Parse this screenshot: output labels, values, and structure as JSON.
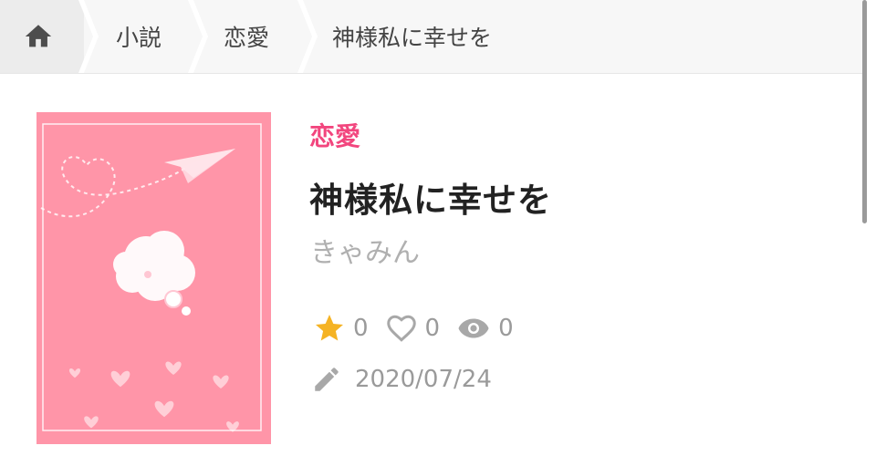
{
  "breadcrumb": {
    "home_icon": "home-icon",
    "items": [
      "小説",
      "恋愛",
      "神様私に幸せを"
    ]
  },
  "book": {
    "genre": "恋愛",
    "title": "神様私に幸せを",
    "author": "きゃみん",
    "stats": {
      "stars": "0",
      "likes": "0",
      "views": "0"
    },
    "updated": "2020/07/24"
  },
  "colors": {
    "genre": "#f2467e",
    "cover_background": "#ff95a8",
    "star": "#f5b324",
    "muted_text": "#9a9a9a"
  },
  "icons": {
    "stars": "star-icon",
    "likes": "heart-icon",
    "views": "eye-icon",
    "updated": "pencil-icon"
  }
}
